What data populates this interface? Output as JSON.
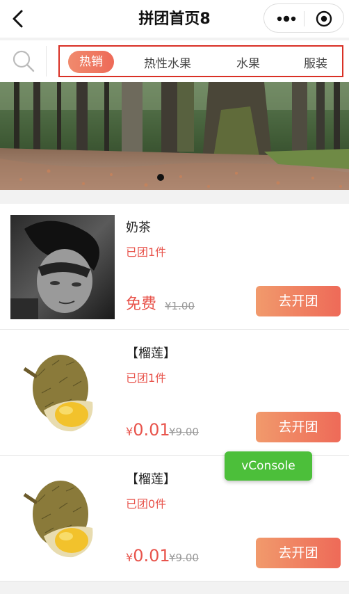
{
  "nav": {
    "title": "拼团首页8"
  },
  "tabs": [
    "热销",
    "热性水果",
    "水果",
    "服装"
  ],
  "items": [
    {
      "name": "奶茶",
      "joined": "已团1件",
      "price_free": "免费",
      "original": "¥1.00",
      "button": "去开团"
    },
    {
      "name": "【榴莲】",
      "joined": "已团1件",
      "currency": "¥",
      "price": "0.01",
      "original": "¥9.00",
      "button": "去开团"
    },
    {
      "name": "【榴莲】",
      "joined": "已团0件",
      "currency": "¥",
      "price": "0.01",
      "original": "¥9.00",
      "button": "去开团"
    }
  ],
  "vconsole": "vConsole",
  "colors": {
    "accent": "#ee6a58",
    "price": "#e8544c",
    "vconsole": "#4cbf3a",
    "tab_outline": "#d93025"
  }
}
